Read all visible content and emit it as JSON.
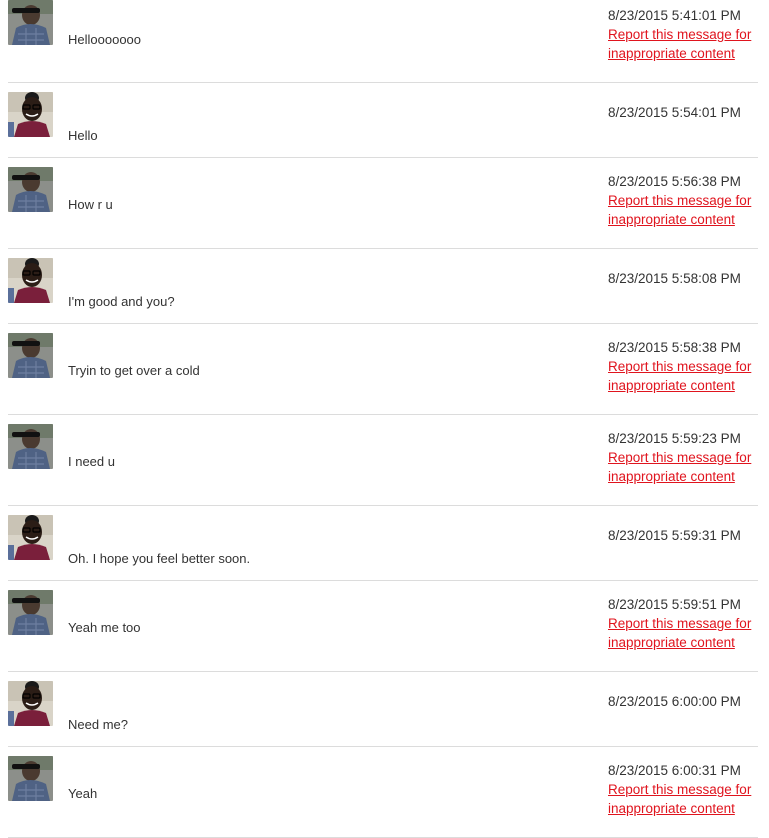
{
  "report_text": "Report this message for inappropriate content",
  "colors": {
    "link": "#e0141e",
    "text": "#333333",
    "divider": "#dcdcdc"
  },
  "messages": [
    {
      "sender": "male",
      "avatar": "man-photo-avatar",
      "text": "Hellooooooo",
      "time": "8/23/2015 5:41:01 PM",
      "reportable": true
    },
    {
      "sender": "female",
      "avatar": "woman-photo-avatar",
      "text": "Hello",
      "time": "8/23/2015 5:54:01 PM",
      "reportable": false
    },
    {
      "sender": "male",
      "avatar": "man-photo-avatar",
      "text": "How r u",
      "time": "8/23/2015 5:56:38 PM",
      "reportable": true
    },
    {
      "sender": "female",
      "avatar": "woman-photo-avatar",
      "text": "I'm good and you?",
      "time": "8/23/2015 5:58:08 PM",
      "reportable": false
    },
    {
      "sender": "male",
      "avatar": "man-photo-avatar",
      "text": "Tryin to get over a cold",
      "time": "8/23/2015 5:58:38 PM",
      "reportable": true
    },
    {
      "sender": "male",
      "avatar": "man-photo-avatar",
      "text": "I need u",
      "time": "8/23/2015 5:59:23 PM",
      "reportable": true
    },
    {
      "sender": "female",
      "avatar": "woman-photo-avatar",
      "text": "Oh. I hope you feel better soon.",
      "time": "8/23/2015 5:59:31 PM",
      "reportable": false
    },
    {
      "sender": "male",
      "avatar": "man-photo-avatar",
      "text": "Yeah me too",
      "time": "8/23/2015 5:59:51 PM",
      "reportable": true
    },
    {
      "sender": "female",
      "avatar": "woman-photo-avatar",
      "text": "Need me?",
      "time": "8/23/2015 6:00:00 PM",
      "reportable": false
    },
    {
      "sender": "male",
      "avatar": "man-photo-avatar",
      "text": "Yeah",
      "time": "8/23/2015 6:00:31 PM",
      "reportable": true
    }
  ]
}
